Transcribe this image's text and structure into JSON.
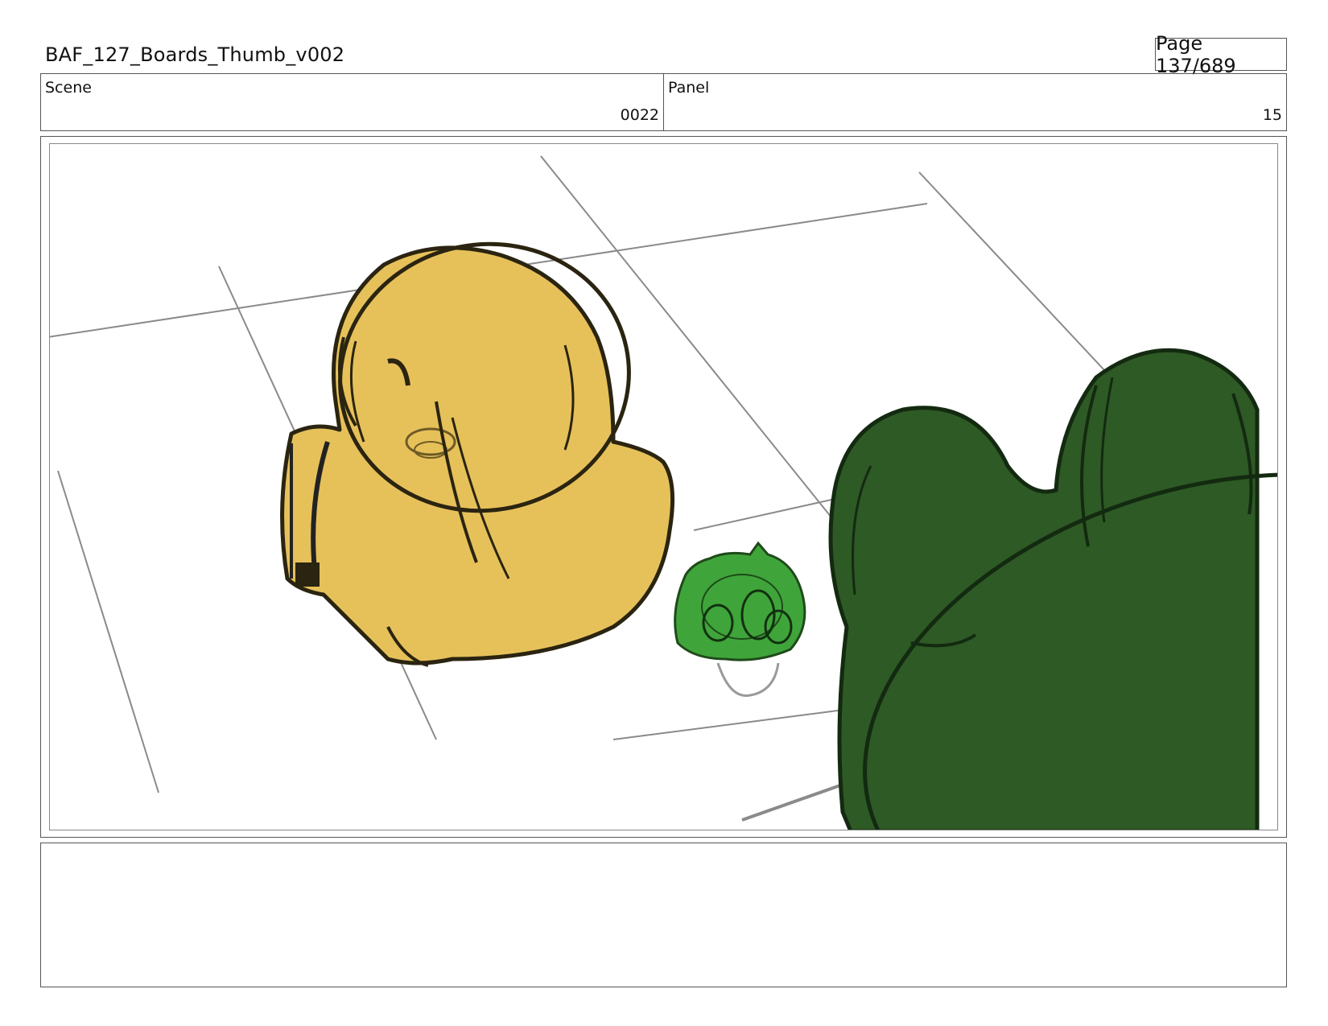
{
  "header": {
    "title": "BAF_127_Boards_Thumb_v002",
    "page_label": "Page 137/689"
  },
  "info": {
    "scene_label": "Scene",
    "scene_value": "0022",
    "panel_label": "Panel",
    "panel_value": "15"
  },
  "colors": {
    "yellow_character": "#E6C15A",
    "small_green_character": "#3FA53A",
    "large_green_character": "#2E5A25",
    "line": "#222222"
  },
  "notes": {
    "text": ""
  }
}
